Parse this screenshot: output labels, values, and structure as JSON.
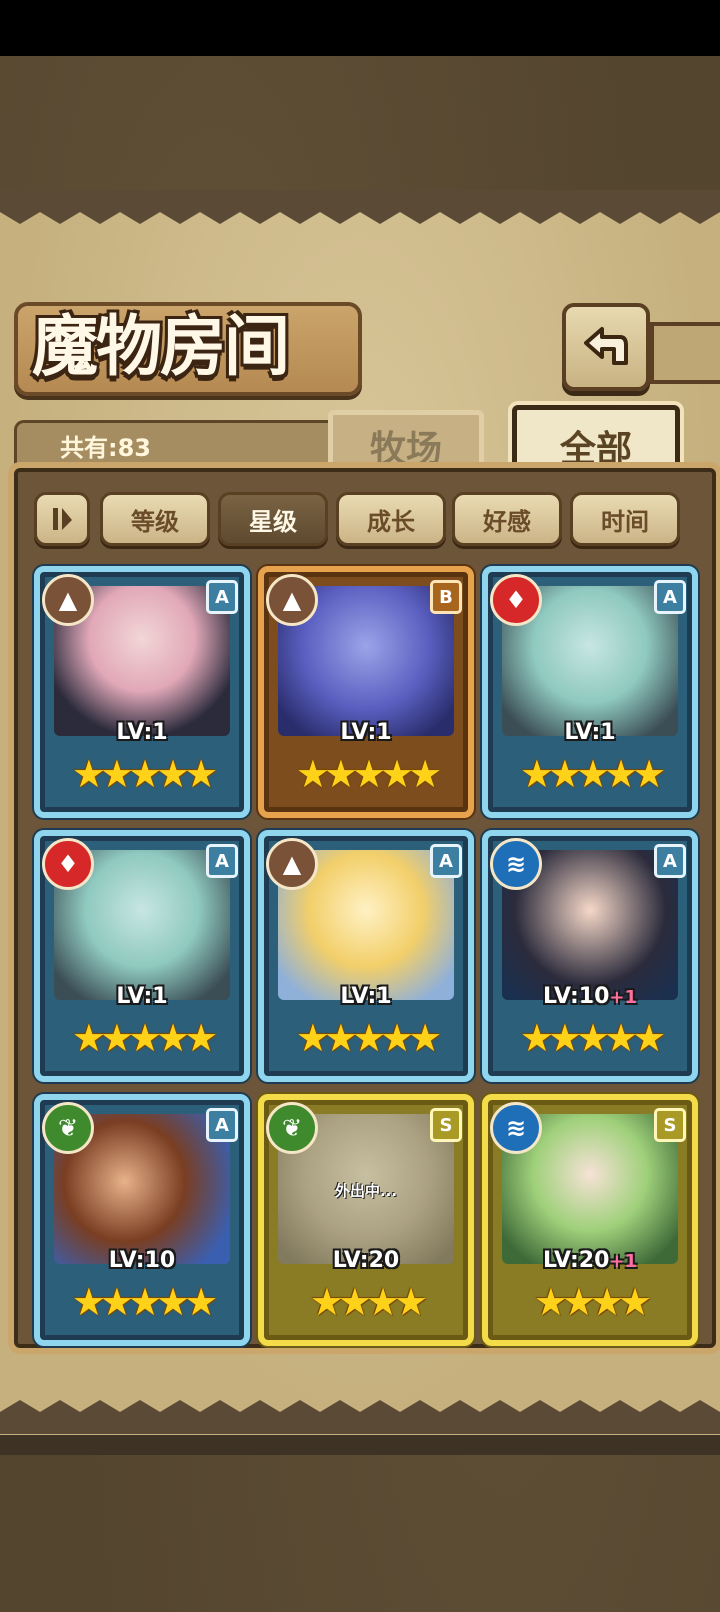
{
  "title": "魔物房间",
  "count_label": "共有:83",
  "tabs": [
    {
      "label": "牧场",
      "active": false
    },
    {
      "label": "全部",
      "active": true
    }
  ],
  "sort_buttons": [
    {
      "label": "等级",
      "active": false
    },
    {
      "label": "星级",
      "active": true
    },
    {
      "label": "成长",
      "active": false
    },
    {
      "label": "好感",
      "active": false
    },
    {
      "label": "时间",
      "active": false
    }
  ],
  "icons": {
    "back": "back-arrow-icon",
    "sort_toggle": "sort-order-icon"
  },
  "stars_text": "★★★★★",
  "monsters": [
    {
      "element": "earth",
      "grade": "A",
      "level": "LV:1",
      "plus": "",
      "stars": 5,
      "status": ""
    },
    {
      "element": "earth",
      "grade": "B",
      "level": "LV:1",
      "plus": "",
      "stars": 5,
      "status": ""
    },
    {
      "element": "fire",
      "grade": "A",
      "level": "LV:1",
      "plus": "",
      "stars": 5,
      "status": ""
    },
    {
      "element": "fire",
      "grade": "A",
      "level": "LV:1",
      "plus": "",
      "stars": 5,
      "status": ""
    },
    {
      "element": "earth",
      "grade": "A",
      "level": "LV:1",
      "plus": "",
      "stars": 5,
      "status": ""
    },
    {
      "element": "water",
      "grade": "A",
      "level": "LV:10",
      "plus": "+1",
      "stars": 5,
      "status": ""
    },
    {
      "element": "grass",
      "grade": "A",
      "level": "LV:10",
      "plus": "",
      "stars": 5,
      "status": ""
    },
    {
      "element": "grass",
      "grade": "S",
      "level": "LV:20",
      "plus": "",
      "stars": 4,
      "status": "外出中..."
    },
    {
      "element": "water",
      "grade": "S",
      "level": "LV:20",
      "plus": "+1",
      "stars": 4,
      "status": ""
    }
  ],
  "colors": {
    "rarity_a": "#8fd5ee",
    "rarity_b": "#e6a24d",
    "rarity_s": "#f3db4a",
    "star": "#ffd21a"
  }
}
